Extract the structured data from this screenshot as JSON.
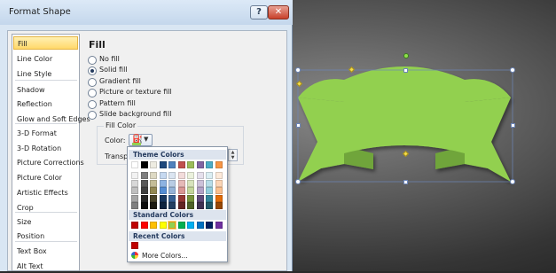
{
  "dialog": {
    "title": "Format Shape",
    "help_label": "?",
    "close_label": "✕"
  },
  "nav": {
    "items": [
      {
        "label": "Fill",
        "selected": true
      },
      {
        "label": "Line Color"
      },
      {
        "label": "Line Style"
      },
      {
        "label": "Shadow"
      },
      {
        "label": "Reflection"
      },
      {
        "label": "Glow and Soft Edges"
      },
      {
        "label": "3-D Format"
      },
      {
        "label": "3-D Rotation"
      },
      {
        "label": "Picture Corrections"
      },
      {
        "label": "Picture Color"
      },
      {
        "label": "Artistic Effects"
      },
      {
        "label": "Crop"
      },
      {
        "label": "Size"
      },
      {
        "label": "Position"
      },
      {
        "label": "Text Box"
      },
      {
        "label": "Alt Text"
      }
    ]
  },
  "fill": {
    "heading": "Fill",
    "options": [
      {
        "label": "No fill",
        "checked": false
      },
      {
        "label": "Solid fill",
        "checked": true
      },
      {
        "label": "Gradient fill",
        "checked": false
      },
      {
        "label": "Picture or texture fill",
        "checked": false
      },
      {
        "label": "Pattern fill",
        "checked": false
      },
      {
        "label": "Slide background fill",
        "checked": false
      }
    ],
    "fill_color_group": "Fill Color",
    "color_label": "Color:",
    "transparency_label": "Transpa",
    "current_color": "#92d050"
  },
  "color_picker": {
    "theme_heading": "Theme Colors",
    "standard_heading": "Standard Colors",
    "recent_heading": "Recent Colors",
    "more_colors": "More Colors...",
    "theme_top": [
      "#ffffff",
      "#000000",
      "#eeece1",
      "#1f497d",
      "#4f81bd",
      "#c0504d",
      "#9bbb59",
      "#8064a2",
      "#4bacc6",
      "#f79646"
    ],
    "theme_shades": [
      [
        "#f2f2f2",
        "#7f7f7f",
        "#ddd9c3",
        "#c6d9f0",
        "#dbe5f1",
        "#f2dcdb",
        "#ebf1dd",
        "#e5e0ec",
        "#dbeef3",
        "#fdeada"
      ],
      [
        "#d8d8d8",
        "#595959",
        "#c4bd97",
        "#8db3e2",
        "#b8cce4",
        "#e5b9b7",
        "#d7e3bc",
        "#ccc1d9",
        "#b7dde8",
        "#fbd5b5"
      ],
      [
        "#bfbfbf",
        "#3f3f3f",
        "#938953",
        "#548dd4",
        "#95b3d7",
        "#d99694",
        "#c3d69b",
        "#b2a2c7",
        "#92cddc",
        "#fac08f"
      ],
      [
        "#a5a5a5",
        "#262626",
        "#494429",
        "#17365d",
        "#366092",
        "#953734",
        "#76923c",
        "#5f497a",
        "#31859b",
        "#e36c09"
      ],
      [
        "#7f7f7f",
        "#0c0c0c",
        "#1d1b10",
        "#0f243e",
        "#244061",
        "#632423",
        "#4f6128",
        "#3f3151",
        "#205867",
        "#974806"
      ]
    ],
    "standard": [
      "#c00000",
      "#ff0000",
      "#ffc000",
      "#ffff00",
      "#92d050",
      "#00b050",
      "#00b0f0",
      "#0070c0",
      "#002060",
      "#7030a0"
    ],
    "standard_selected_index": 4,
    "recent": [
      "#c00000"
    ]
  },
  "shape": {
    "fill": "#92d050"
  }
}
